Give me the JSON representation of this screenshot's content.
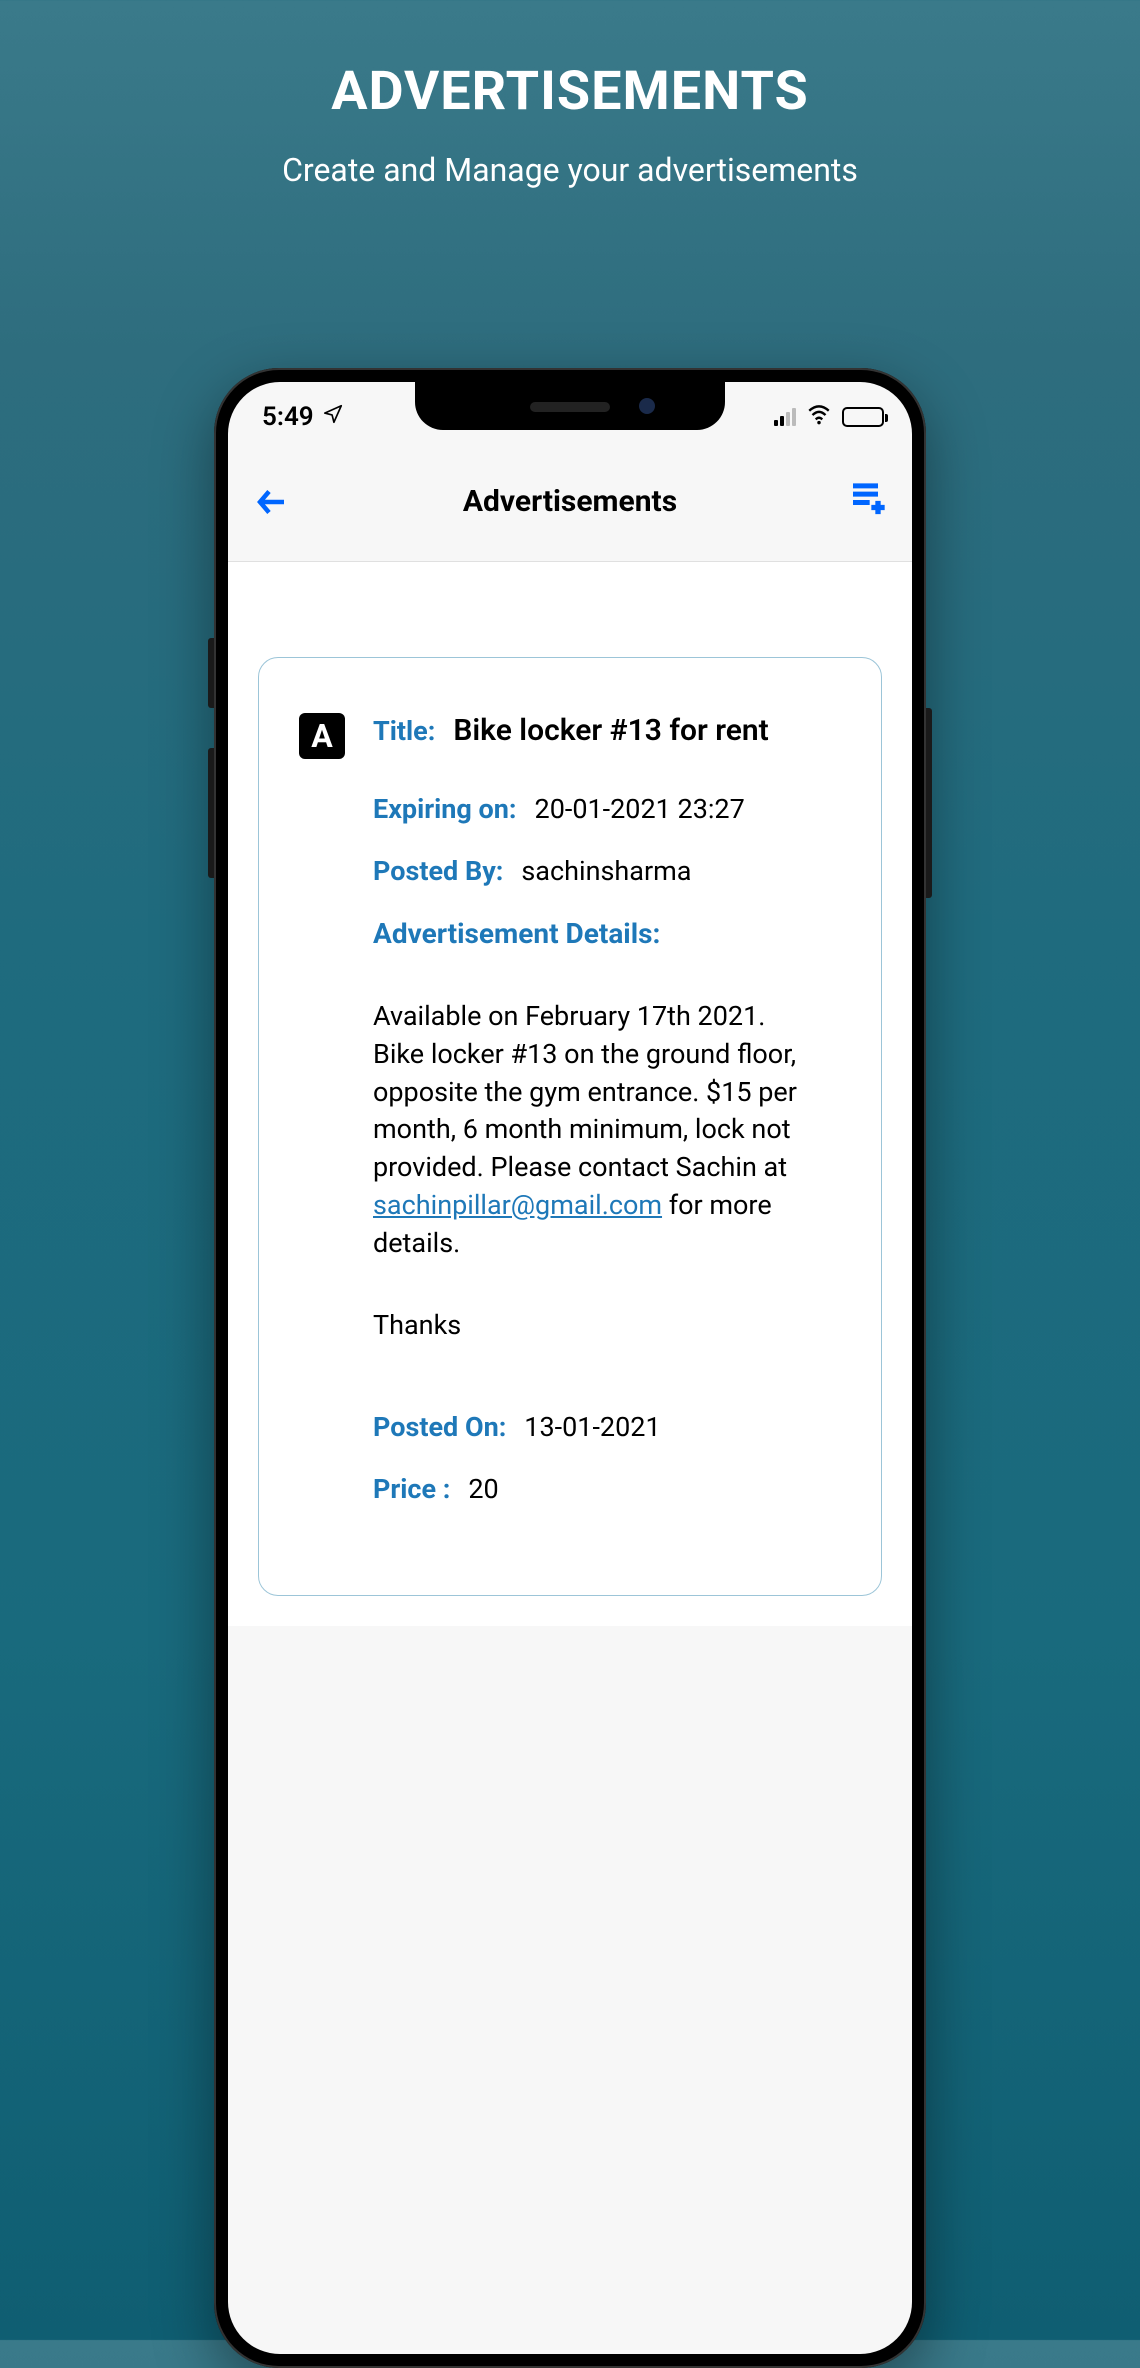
{
  "promo": {
    "title": "ADVERTISEMENTS",
    "subtitle": "Create and Manage your advertisements"
  },
  "status": {
    "time": "5:49"
  },
  "header": {
    "title": "Advertisements"
  },
  "ad": {
    "badge": "A",
    "title_label": "Title:",
    "title": "Bike locker #13 for rent",
    "expiring_label": "Expiring on:",
    "expiring": "20-01-2021 23:27",
    "posted_by_label": "Posted By:",
    "posted_by": "sachinsharma",
    "details_label": "Advertisement Details:",
    "details_pre": "Available on February 17th 2021. Bike locker #13 on the ground floor, opposite the gym entrance.  $15 per month, 6 month minimum, lock not provided. Please contact Sachin at ",
    "details_email": "sachinpillar@gmail.com",
    "details_post": " for more details.",
    "thanks": "Thanks",
    "posted_on_label": "Posted On:",
    "posted_on": "13-01-2021",
    "price_label": "Price :",
    "price": "20"
  }
}
